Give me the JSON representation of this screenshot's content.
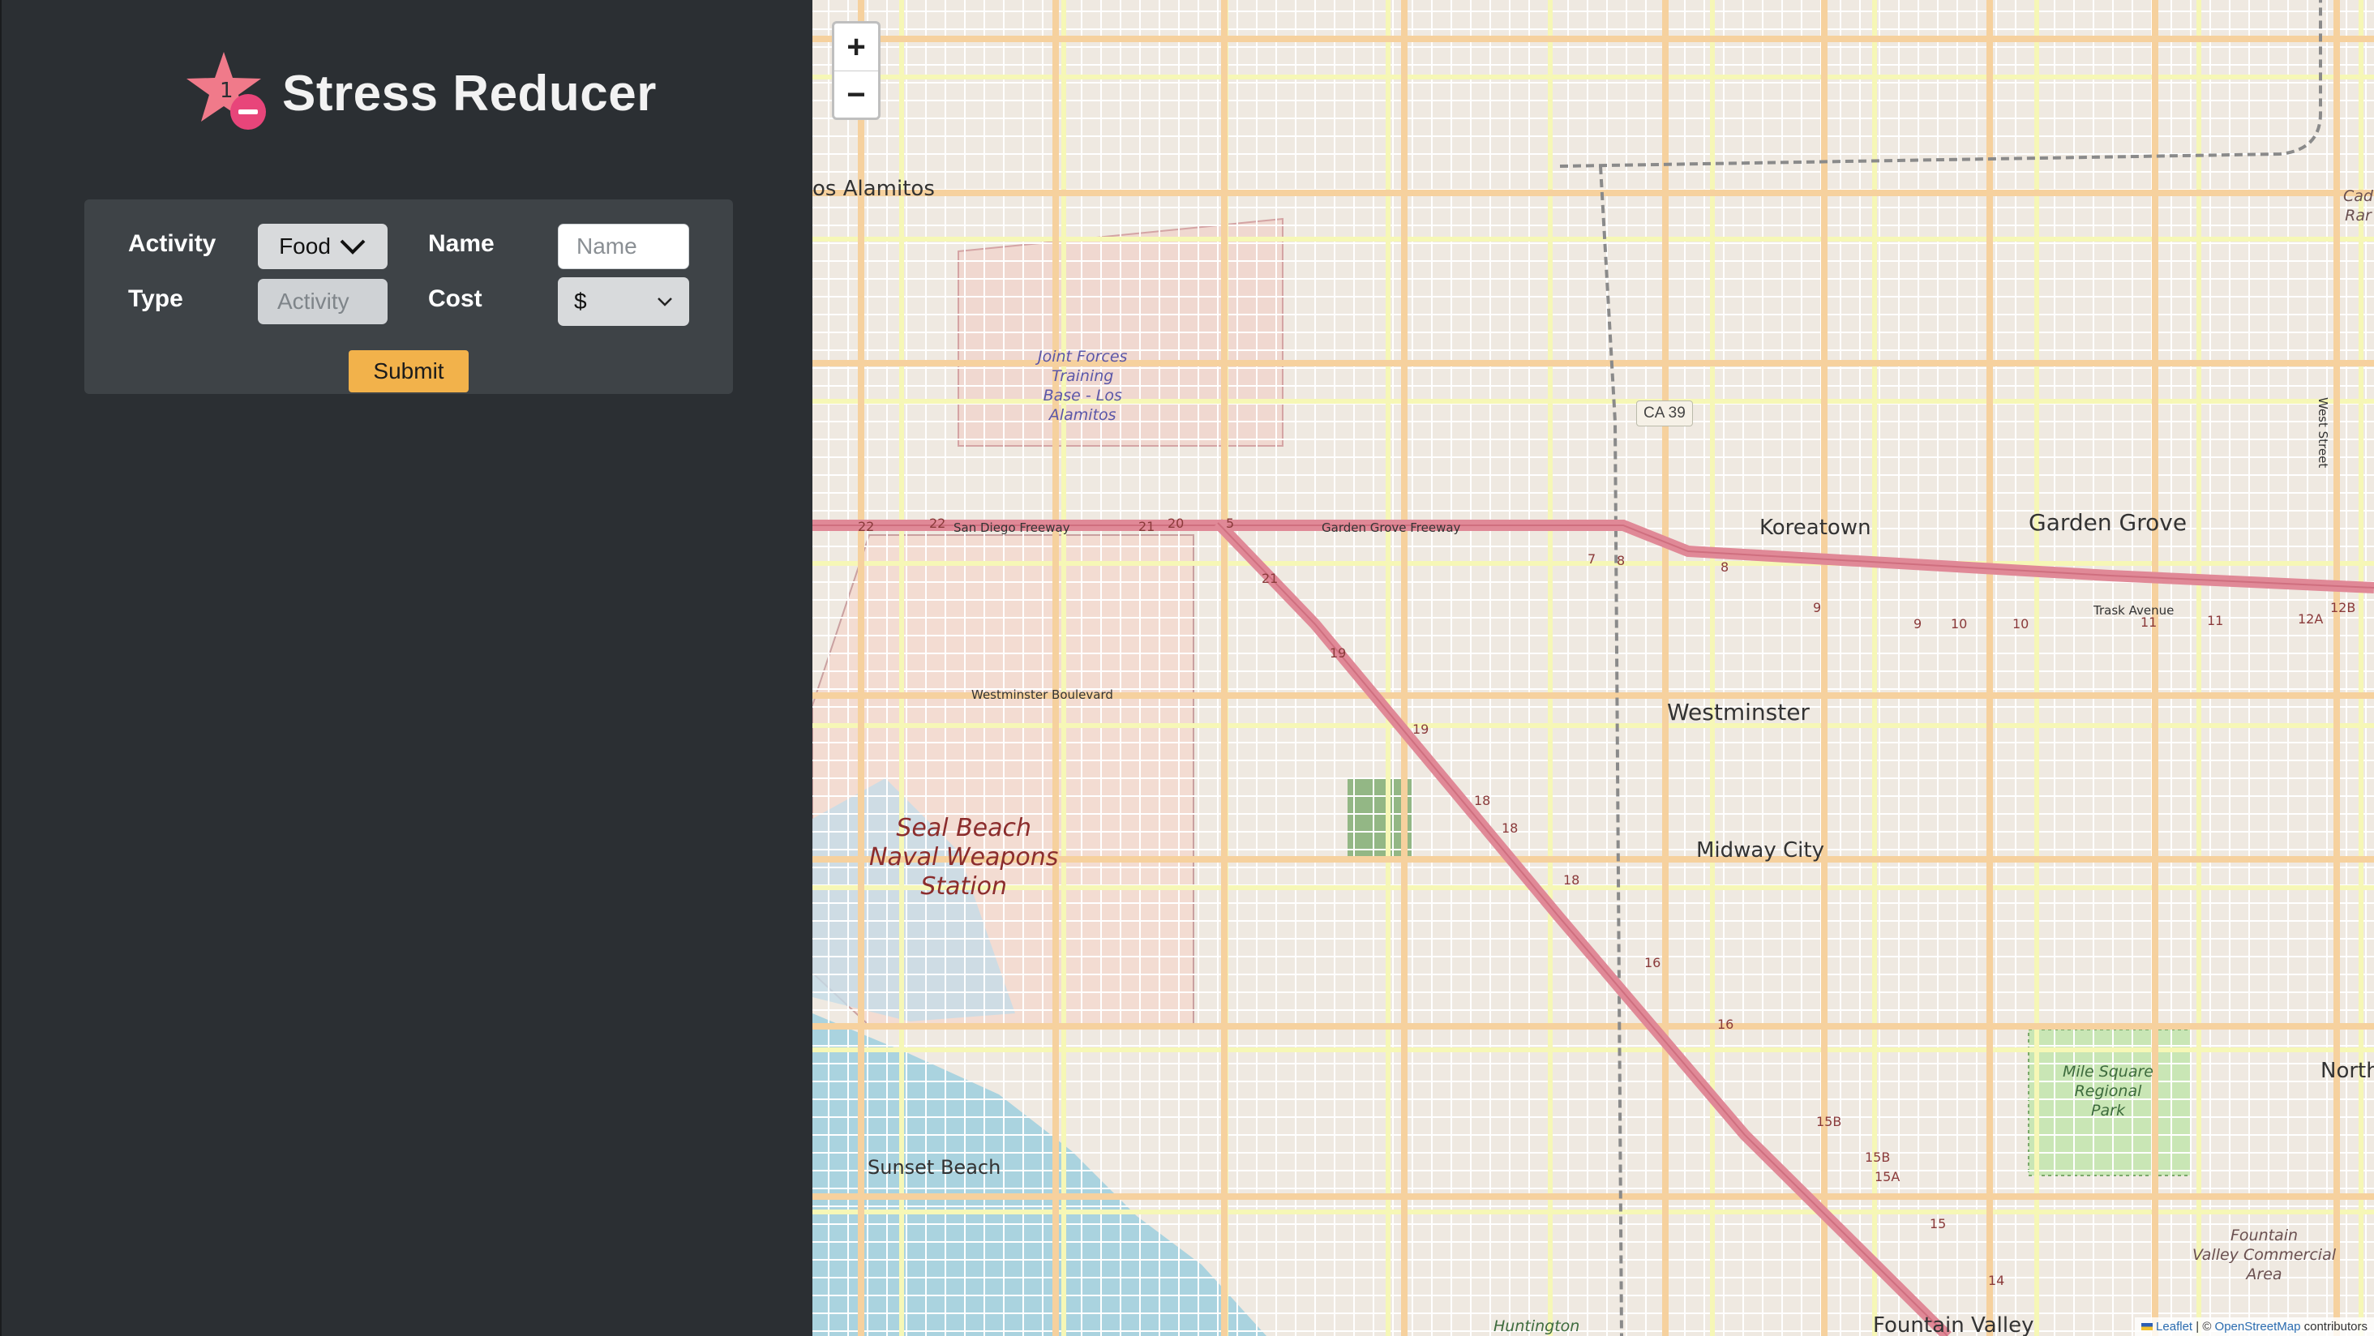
{
  "app": {
    "title": "Stress Reducer",
    "logo": {
      "badge": "1",
      "icon": "star-minus-icon"
    }
  },
  "form": {
    "activity_label": "Activity",
    "activity_value": "Food",
    "name_label": "Name",
    "name_placeholder": "Name",
    "type_label": "Type",
    "type_placeholder": "Activity",
    "cost_label": "Cost",
    "cost_value": "$",
    "submit_label": "Submit"
  },
  "map": {
    "zoom_in": "+",
    "zoom_out": "−",
    "shield": "CA 39",
    "places": {
      "los_alamitos": "os Alamitos",
      "koreatown": "Koreatown",
      "garden_grove": "Garden Grove",
      "westminster": "Westminster",
      "midway_city": "Midway City",
      "sunset_beach": "Sunset Beach",
      "fountain_valley": "Fountain Valley",
      "north": "North",
      "huntington": "Huntington"
    },
    "pois": {
      "seal_beach": "Seal Beach\nNaval Weapons\nStation",
      "joint_forces": "Joint Forces\nTraining\nBase - Los\nAlamitos",
      "mile_square": "Mile Square\nRegional\nPark",
      "fountain_valley_commercial": "Fountain\nValley Commercial\nArea",
      "cad_rar": "Cad\nRar"
    },
    "roads": {
      "san_diego_freeway": "San Diego Freeway",
      "garden_grove_freeway": "Garden Grove Freeway",
      "trask_avenue": "Trask Avenue",
      "westminster_boulevard": "Westminster Boulevard",
      "west_street": "West Street"
    },
    "exits": [
      "22",
      "22",
      "21",
      "20",
      "5",
      "21",
      "19",
      "19",
      "18",
      "18",
      "18",
      "16",
      "16",
      "15B",
      "15B",
      "15A",
      "15",
      "14",
      "7",
      "8",
      "8",
      "9",
      "9",
      "10",
      "10",
      "11",
      "11",
      "12A",
      "12B"
    ],
    "attribution": {
      "leaflet": "Leaflet",
      "sep": " | © ",
      "osm": "OpenStreetMap",
      "suffix": " contributors"
    },
    "colors": {
      "land": "#efe9e1",
      "minor_road": "#ffffff",
      "arterial": "#f6d19e",
      "collector": "#f6f7b6",
      "freeway": "#e08997",
      "water": "#aad3df",
      "park": "#cdebb0",
      "military": "#f0d8d0",
      "railway": "#8a8a8a"
    }
  }
}
